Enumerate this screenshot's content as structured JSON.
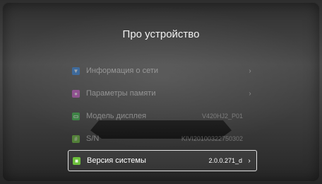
{
  "title": "Про устройство",
  "items": [
    {
      "label": "Информация о сети",
      "value": "",
      "chevron": "›",
      "icon": "network-icon",
      "color": "#2f7fd8"
    },
    {
      "label": "Параметры памяти",
      "value": "",
      "chevron": "›",
      "icon": "memory-icon",
      "color": "#c85ac8"
    },
    {
      "label": "Модель дисплея",
      "value": "V420HJ2_P01",
      "chevron": "",
      "icon": "display-icon",
      "color": "#3cb84a"
    },
    {
      "label": "S/N",
      "value": "KIVI20100322750302",
      "chevron": "",
      "icon": "hash-icon",
      "color": "#6cbf3c"
    },
    {
      "label": "Версия системы",
      "value": "2.0.0.271_d",
      "chevron": "›",
      "icon": "system-icon",
      "color": "#6cbf3c",
      "selected": true
    }
  ]
}
